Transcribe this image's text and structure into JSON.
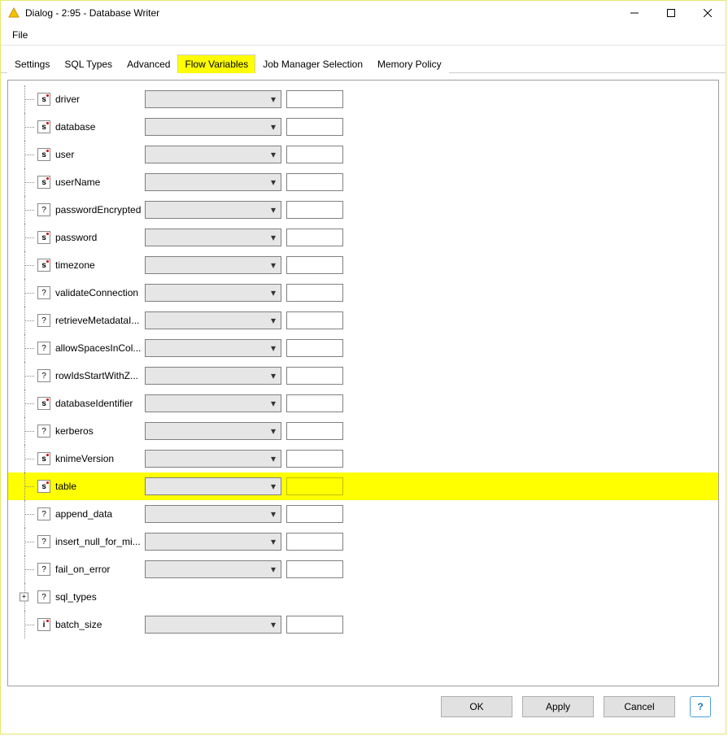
{
  "window": {
    "title": "Dialog - 2:95 - Database Writer"
  },
  "menubar": {
    "file": "File"
  },
  "tabs": [
    {
      "id": "settings",
      "label": "Settings",
      "active": false,
      "highlight": false
    },
    {
      "id": "sql-types",
      "label": "SQL Types",
      "active": false,
      "highlight": false
    },
    {
      "id": "advanced",
      "label": "Advanced",
      "active": false,
      "highlight": false
    },
    {
      "id": "flow-variables",
      "label": "Flow Variables",
      "active": true,
      "highlight": true
    },
    {
      "id": "job-manager",
      "label": "Job Manager Selection",
      "active": false,
      "highlight": false
    },
    {
      "id": "memory-policy",
      "label": "Memory Policy",
      "active": false,
      "highlight": false
    }
  ],
  "rows": [
    {
      "icon": "s",
      "label": "driver",
      "inputs": true,
      "hl": false,
      "expand": false
    },
    {
      "icon": "s",
      "label": "database",
      "inputs": true,
      "hl": false,
      "expand": false
    },
    {
      "icon": "s",
      "label": "user",
      "inputs": true,
      "hl": false,
      "expand": false
    },
    {
      "icon": "s",
      "label": "userName",
      "inputs": true,
      "hl": false,
      "expand": false
    },
    {
      "icon": "?",
      "label": "passwordEncrypted",
      "inputs": true,
      "hl": false,
      "expand": false
    },
    {
      "icon": "s",
      "label": "password",
      "inputs": true,
      "hl": false,
      "expand": false
    },
    {
      "icon": "s",
      "label": "timezone",
      "inputs": true,
      "hl": false,
      "expand": false
    },
    {
      "icon": "?",
      "label": "validateConnection",
      "inputs": true,
      "hl": false,
      "expand": false
    },
    {
      "icon": "?",
      "label": "retrieveMetadataI...",
      "inputs": true,
      "hl": false,
      "expand": false
    },
    {
      "icon": "?",
      "label": "allowSpacesInCol...",
      "inputs": true,
      "hl": false,
      "expand": false
    },
    {
      "icon": "?",
      "label": "rowIdsStartWithZ...",
      "inputs": true,
      "hl": false,
      "expand": false
    },
    {
      "icon": "s",
      "label": "databaseIdentifier",
      "inputs": true,
      "hl": false,
      "expand": false
    },
    {
      "icon": "?",
      "label": "kerberos",
      "inputs": true,
      "hl": false,
      "expand": false
    },
    {
      "icon": "s",
      "label": "knimeVersion",
      "inputs": true,
      "hl": false,
      "expand": false
    },
    {
      "icon": "s",
      "label": "table",
      "inputs": true,
      "hl": true,
      "expand": false
    },
    {
      "icon": "?",
      "label": "append_data",
      "inputs": true,
      "hl": false,
      "expand": false
    },
    {
      "icon": "?",
      "label": "insert_null_for_mi...",
      "inputs": true,
      "hl": false,
      "expand": false
    },
    {
      "icon": "?",
      "label": "fail_on_error",
      "inputs": true,
      "hl": false,
      "expand": false
    },
    {
      "icon": "?",
      "label": "sql_types",
      "inputs": false,
      "hl": false,
      "expand": true
    },
    {
      "icon": "i",
      "label": "batch_size",
      "inputs": true,
      "hl": false,
      "expand": false
    }
  ],
  "buttons": {
    "ok": "OK",
    "apply": "Apply",
    "cancel": "Cancel",
    "help": "?"
  },
  "glyphs": {
    "s": "s",
    "q": "?",
    "i": "i",
    "plus": "+"
  }
}
